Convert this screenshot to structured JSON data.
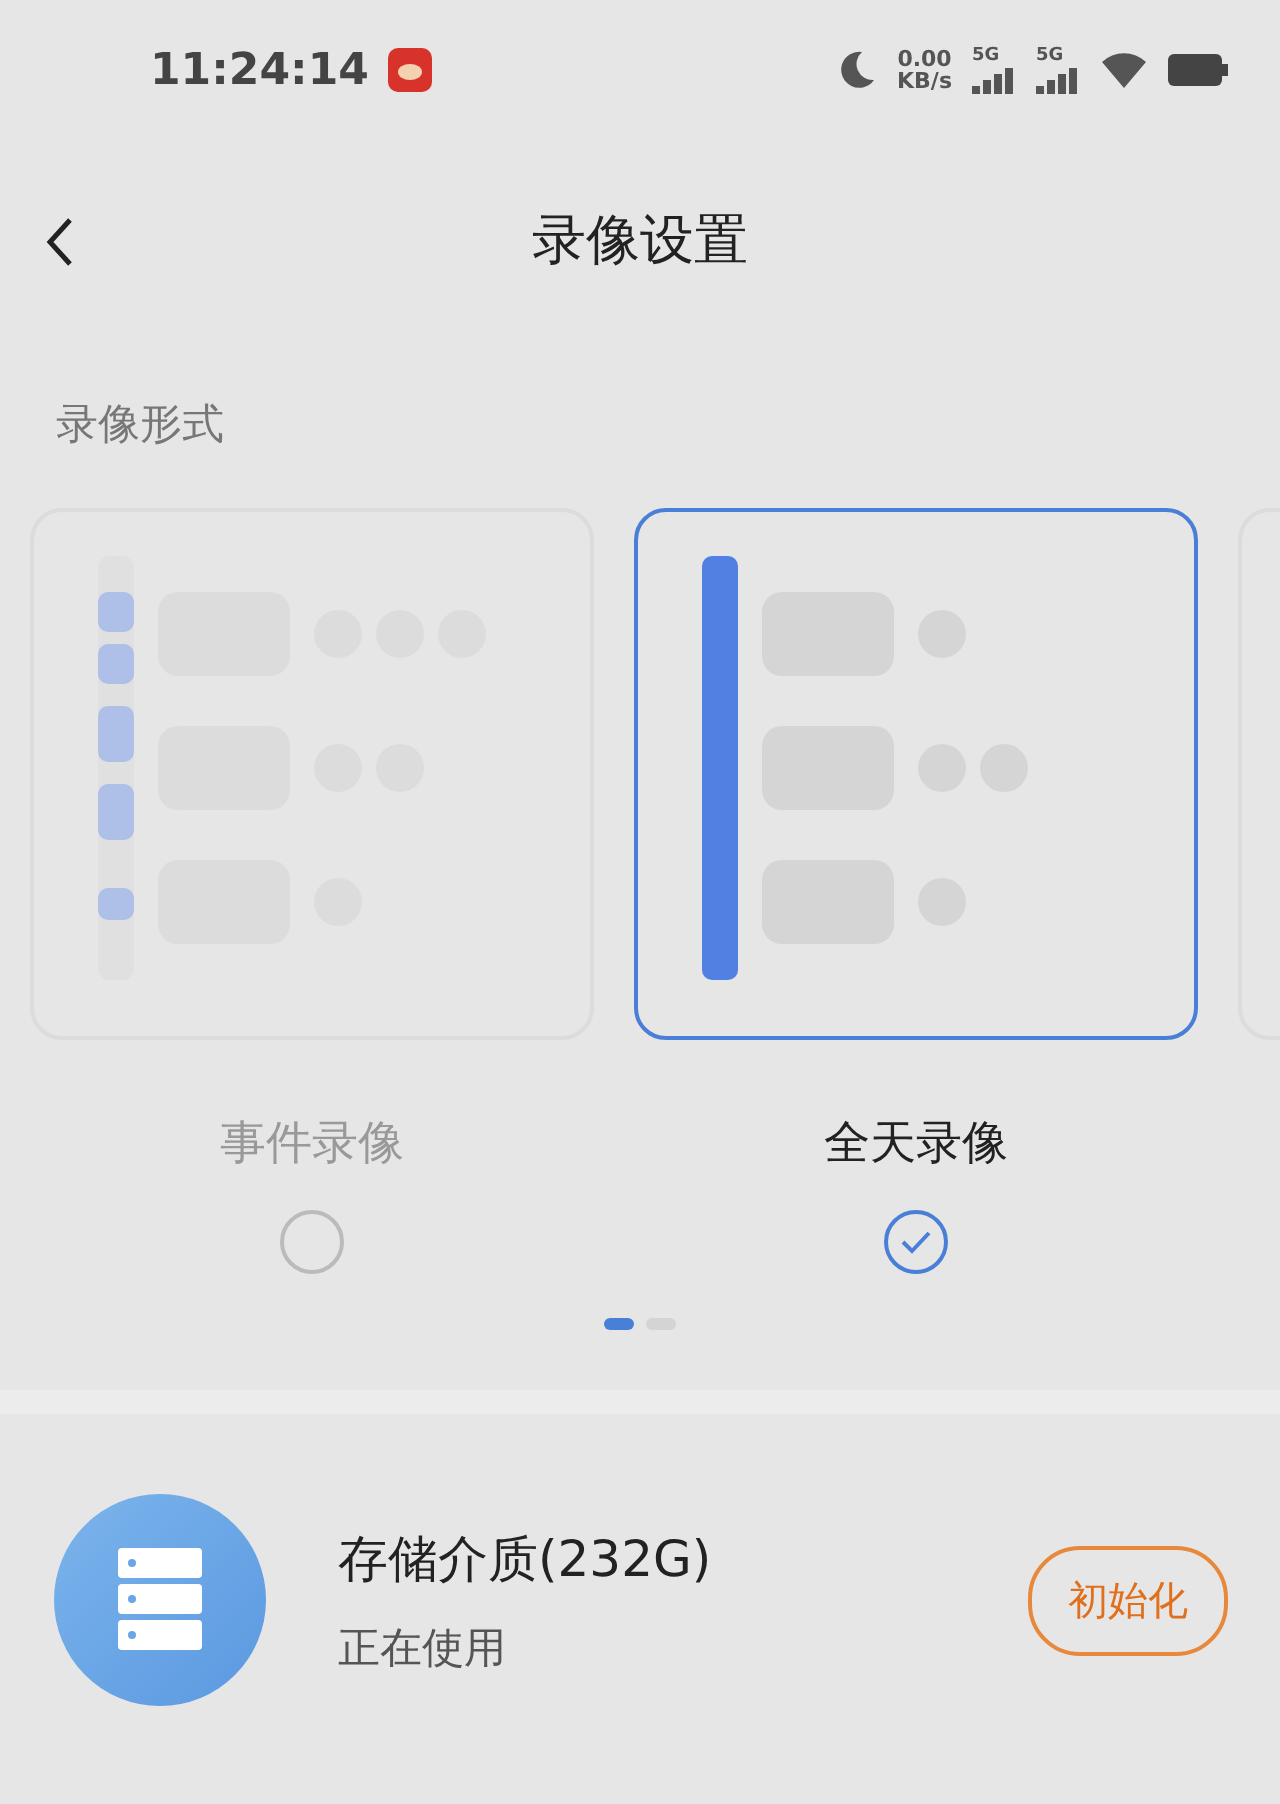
{
  "status_bar": {
    "time": "11:24:14",
    "net_speed": "0.00",
    "net_unit": "KB/s",
    "signals": [
      {
        "label": "5G"
      },
      {
        "label": "5G"
      }
    ]
  },
  "header": {
    "title": "录像设置"
  },
  "section_title": "录像形式",
  "record_modes": [
    {
      "kind": "event",
      "label": "事件录像",
      "selected": false
    },
    {
      "kind": "allday",
      "label": "全天录像",
      "selected": true
    }
  ],
  "pager": [
    {
      "selected": true
    },
    {
      "selected": false
    }
  ],
  "storage": {
    "title": "存储介质(232G)",
    "status": "正在使用",
    "button": "初始化"
  }
}
